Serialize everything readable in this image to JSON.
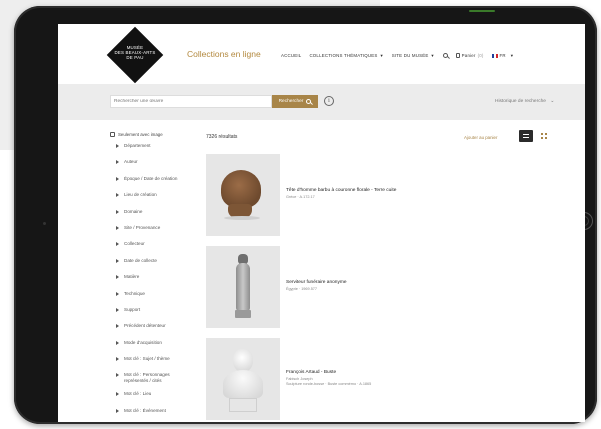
{
  "header": {
    "logo_lines": [
      "MUSÉE",
      "DES BEAUX-ARTS",
      "DE PAU"
    ],
    "site_title": "Collections en ligne",
    "nav": {
      "home": "ACCUEIL",
      "thematic": "COLLECTIONS THÉMATIQUES",
      "museum_site": "SITE DU MUSÉE",
      "basket": "Panier",
      "basket_count": "(0)",
      "language": "FR"
    }
  },
  "search": {
    "placeholder": "Rechercher une œuvre",
    "button_label": "Rechercher",
    "info": "i",
    "history_label": "Historique de recherche"
  },
  "sidebar": {
    "only_images_label": "Seulement avec image",
    "facets": [
      "Département",
      "Auteur",
      "Époque / Date de création",
      "Lieu de création",
      "Domaine",
      "Site / Provenance",
      "Collecteur",
      "Date de collecte",
      "Matière",
      "Technique",
      "Support",
      "Précédent détenteur",
      "Mode d'acquisition",
      "Mot clé : Sujet / thème",
      "Mot clé : Personnages représentés / cités",
      "Mot clé : Lieu",
      "Mot clé : Événement"
    ]
  },
  "results": {
    "count_label": "7326 résultats",
    "add_to_basket": "Ajouter au panier",
    "items": [
      {
        "title": "Tête d'homme barbu à couronne florale - Terre cuite",
        "meta1": "Grèce · A.172.17",
        "meta2": ""
      },
      {
        "title": "Serviteur funéraire anonyme",
        "meta1": "Égypte · 1969.577",
        "meta2": ""
      },
      {
        "title": "François Artaud - Buste",
        "meta1": "Fabisch Joseph",
        "meta2": "Sculpture ronde-bosse · Buste commémo · A.1865"
      }
    ]
  },
  "colors": {
    "accent": "#a88548",
    "title_gold": "#b3893f",
    "band": "#ececec",
    "device": "#161616"
  }
}
